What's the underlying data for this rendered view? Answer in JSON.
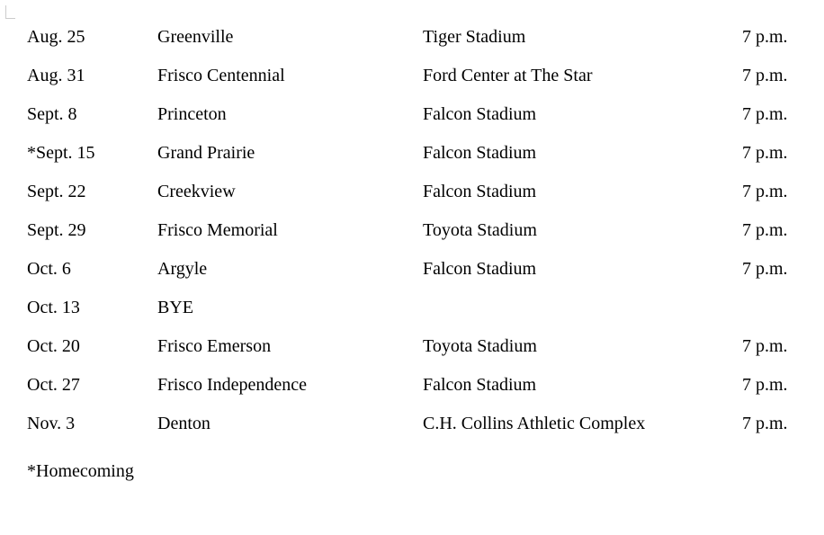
{
  "schedule": [
    {
      "date": "Aug. 25",
      "opponent": "Greenville",
      "location": "Tiger Stadium",
      "time": "7 p.m."
    },
    {
      "date": "Aug. 31",
      "opponent": "Frisco Centennial",
      "location": "Ford Center at The Star",
      "time": "7 p.m."
    },
    {
      "date": "Sept. 8",
      "opponent": "Princeton",
      "location": "Falcon Stadium",
      "time": "7 p.m."
    },
    {
      "date": "*Sept. 15",
      "opponent": "Grand Prairie",
      "location": "Falcon Stadium",
      "time": "7 p.m."
    },
    {
      "date": "Sept. 22",
      "opponent": "Creekview",
      "location": "Falcon Stadium",
      "time": "7 p.m."
    },
    {
      "date": "Sept. 29",
      "opponent": "Frisco Memorial",
      "location": "Toyota Stadium",
      "time": "7 p.m."
    },
    {
      "date": "Oct. 6",
      "opponent": "Argyle",
      "location": "Falcon Stadium",
      "time": "7 p.m."
    },
    {
      "date": "Oct. 13",
      "opponent": "BYE",
      "location": "",
      "time": ""
    },
    {
      "date": "Oct. 20",
      "opponent": "Frisco Emerson",
      "location": "Toyota Stadium",
      "time": "7 p.m."
    },
    {
      "date": "Oct. 27",
      "opponent": "Frisco Independence",
      "location": "Falcon Stadium",
      "time": "7 p.m."
    },
    {
      "date": "Nov. 3",
      "opponent": "Denton",
      "location": "C.H. Collins Athletic Complex",
      "time": "7 p.m."
    }
  ],
  "footnote": "*Homecoming"
}
